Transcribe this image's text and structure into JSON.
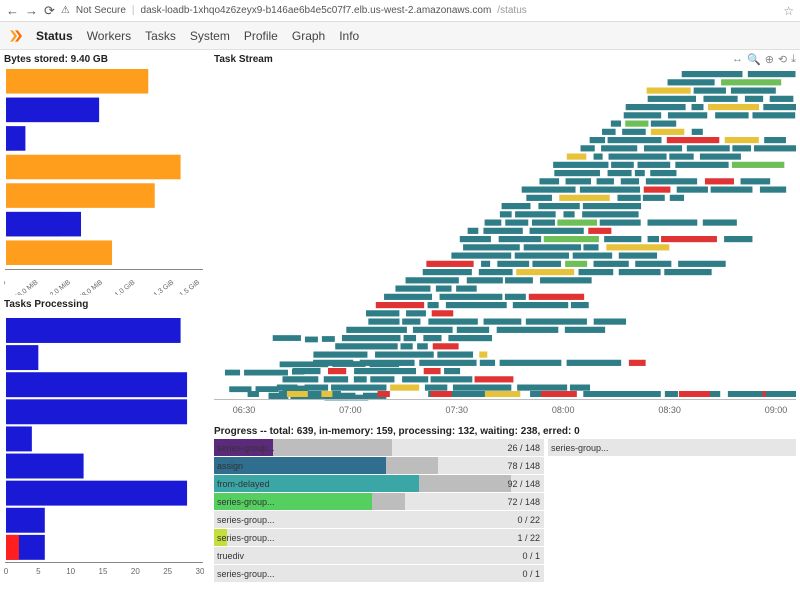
{
  "browser": {
    "back": "←",
    "forward": "→",
    "reload": "⟳",
    "security_label": "Not Secure",
    "url_host": "dask-loadb-1xhqo4z6zeyx9-b146ae6b4e5c07f7.elb.us-west-2.amazonaws.com",
    "url_path": "/status",
    "star": "☆"
  },
  "nav": {
    "items": [
      "Status",
      "Workers",
      "Tasks",
      "System",
      "Profile",
      "Graph",
      "Info"
    ],
    "active": "Status"
  },
  "bytes_stored": {
    "title": "Bytes stored: 9.40 GB",
    "ticks": [
      "0.0",
      "256.0 MiB",
      "512.0 MiB",
      "768.0 MiB",
      "1.0 GiB",
      "1.3 GiB",
      "1.5 GiB"
    ]
  },
  "tasks_processing": {
    "title": "Tasks Processing",
    "ticks": [
      "0",
      "5",
      "10",
      "15",
      "20",
      "25",
      "30"
    ]
  },
  "task_stream": {
    "title": "Task Stream",
    "ticks": [
      "06:30",
      "07:00",
      "07:30",
      "08:00",
      "08:30",
      "09:00"
    ]
  },
  "progress": {
    "header": "Progress -- total: 639, in-memory: 159, processing: 132, waiting: 238, erred: 0",
    "rows": [
      {
        "label": "series-group...",
        "count": "26 / 148",
        "fill_pct": 18,
        "fill_color": "#5b2a7a",
        "tail_pct": 36
      },
      {
        "label": "assign",
        "count": "78 / 148",
        "fill_pct": 52,
        "fill_color": "#2f6e8e",
        "tail_pct": 16
      },
      {
        "label": "from-delayed",
        "count": "92 / 148",
        "fill_pct": 62,
        "fill_color": "#3aa6a6",
        "tail_pct": 28
      },
      {
        "label": "series-group...",
        "count": "72 / 148",
        "fill_pct": 48,
        "fill_color": "#55d060",
        "tail_pct": 10
      },
      {
        "label": "series-group...",
        "count": "0 / 22",
        "fill_pct": 0,
        "fill_color": "#c4de3d",
        "tail_pct": 0
      },
      {
        "label": "series-group...",
        "count": "1 / 22",
        "fill_pct": 4,
        "fill_color": "#c4de3d",
        "tail_pct": 0
      },
      {
        "label": "truediv",
        "count": "0 / 1",
        "fill_pct": 0,
        "fill_color": "#ccc",
        "tail_pct": 0
      },
      {
        "label": "series-group...",
        "count": "0 / 1",
        "fill_pct": 0,
        "fill_color": "#ccc",
        "tail_pct": 0
      }
    ],
    "side_rows": [
      {
        "label": "series-group...",
        "count": ""
      }
    ]
  },
  "chart_data": {
    "bytes_stored": {
      "type": "bar",
      "orientation": "horizontal",
      "xlabel": "",
      "ylabel": "",
      "xlim": [
        0,
        1.5
      ],
      "x_ticks": [
        0,
        0.25,
        0.5,
        0.75,
        1.0,
        1.3,
        1.5
      ],
      "x_tick_labels": [
        "0.0",
        "256.0 MiB",
        "512.0 MiB",
        "768.0 MiB",
        "1.0 GiB",
        "1.3 GiB",
        "1.5 GiB"
      ],
      "series": [
        {
          "name": "used",
          "color": "#ff9d1c",
          "values": [
            1.1,
            0.58,
            0.05,
            1.35,
            1.15,
            0.42,
            0.82
          ]
        },
        {
          "name": "other",
          "color": "#1a1ad6",
          "values": [
            0.0,
            0.72,
            0.15,
            0.0,
            0.0,
            0.58,
            0.0
          ]
        }
      ]
    },
    "tasks_processing": {
      "type": "bar",
      "orientation": "horizontal",
      "xlabel": "",
      "ylabel": "",
      "xlim": [
        0,
        30
      ],
      "x_ticks": [
        0,
        5,
        10,
        15,
        20,
        25,
        30
      ],
      "series": [
        {
          "name": "processing",
          "color": "#1a1ad6",
          "values": [
            27,
            5,
            28,
            28,
            4,
            12,
            28,
            6,
            6
          ]
        },
        {
          "name": "erred",
          "color": "#ff1f1f",
          "values": [
            0,
            0,
            0,
            0,
            0,
            0,
            0,
            0,
            2
          ]
        }
      ]
    },
    "task_stream": {
      "type": "gantt",
      "x_ticks": [
        "06:30",
        "07:00",
        "07:30",
        "08:00",
        "08:30",
        "09:00"
      ],
      "colors": {
        "primary": "#2f7e87",
        "accent1": "#e7c23b",
        "accent2": "#e03434",
        "accent3": "#6fbf59"
      },
      "note": "approximate segment positions; rendered decoratively"
    }
  }
}
